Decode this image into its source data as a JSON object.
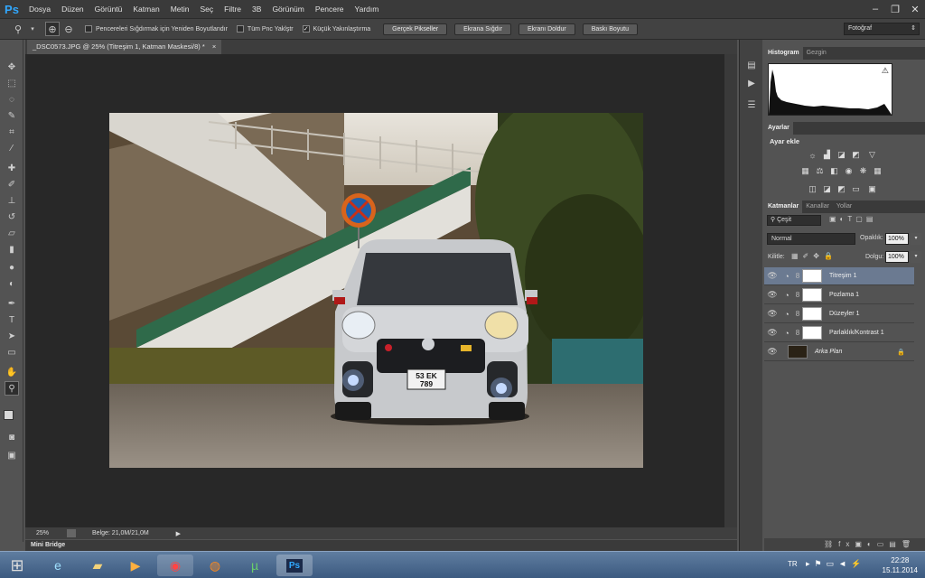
{
  "app": {
    "logo": "Ps"
  },
  "menu": [
    "Dosya",
    "Düzen",
    "Görüntü",
    "Katman",
    "Metin",
    "Seç",
    "Filtre",
    "3B",
    "Görünüm",
    "Pencere",
    "Yardım"
  ],
  "options": {
    "check1": "Pencereleri Sığdırmak için Yeniden Boyutlandır",
    "check2": "Tüm Pnc Yaklştr",
    "check3": "Küçük Yakınlaştırma",
    "check3_mark": "✓",
    "btn1": "Gerçek Pikseller",
    "btn2": "Ekrana Sığdır",
    "btn3": "Ekranı Doldur",
    "btn4": "Baskı Boyutu",
    "workspace": "Fotoğraf"
  },
  "document": {
    "tab": "_DSC0573.JPG @ 25% (Titreşim 1, Katman Maskesi/8) *",
    "close": "×"
  },
  "status": {
    "zoom": "25%",
    "doc": "Belge: 21,0M/21,0M"
  },
  "minibridge": "Mini Bridge",
  "panels": {
    "histogram_tabs": [
      "Histogram",
      "Gezgin"
    ],
    "adjust_tab": "Ayarlar",
    "adjust_title": "Ayar ekle",
    "layer_tabs": [
      "Katmanlar",
      "Kanallar",
      "Yollar"
    ],
    "filter": "Çeşit",
    "blend": "Normal",
    "opacity_label": "Opaklık:",
    "opacity": "100%",
    "lock_label": "Kilitle:",
    "fill_label": "Dolgu:",
    "fill": "100%",
    "layers": [
      {
        "name": "Titreşim 1"
      },
      {
        "name": "Pozlama 1"
      },
      {
        "name": "Düzeyler 1"
      },
      {
        "name": "Parlaklık/Kontrast 1"
      },
      {
        "name": "Arka Plan"
      }
    ]
  },
  "photo": {
    "plate": "53  EK\n789"
  },
  "taskbar": {
    "lang": "TR",
    "time": "22:28",
    "date": "15.11.2014"
  },
  "colors": {
    "ps_blue": "#31a8ff",
    "selected_layer": "#6b7a91"
  }
}
